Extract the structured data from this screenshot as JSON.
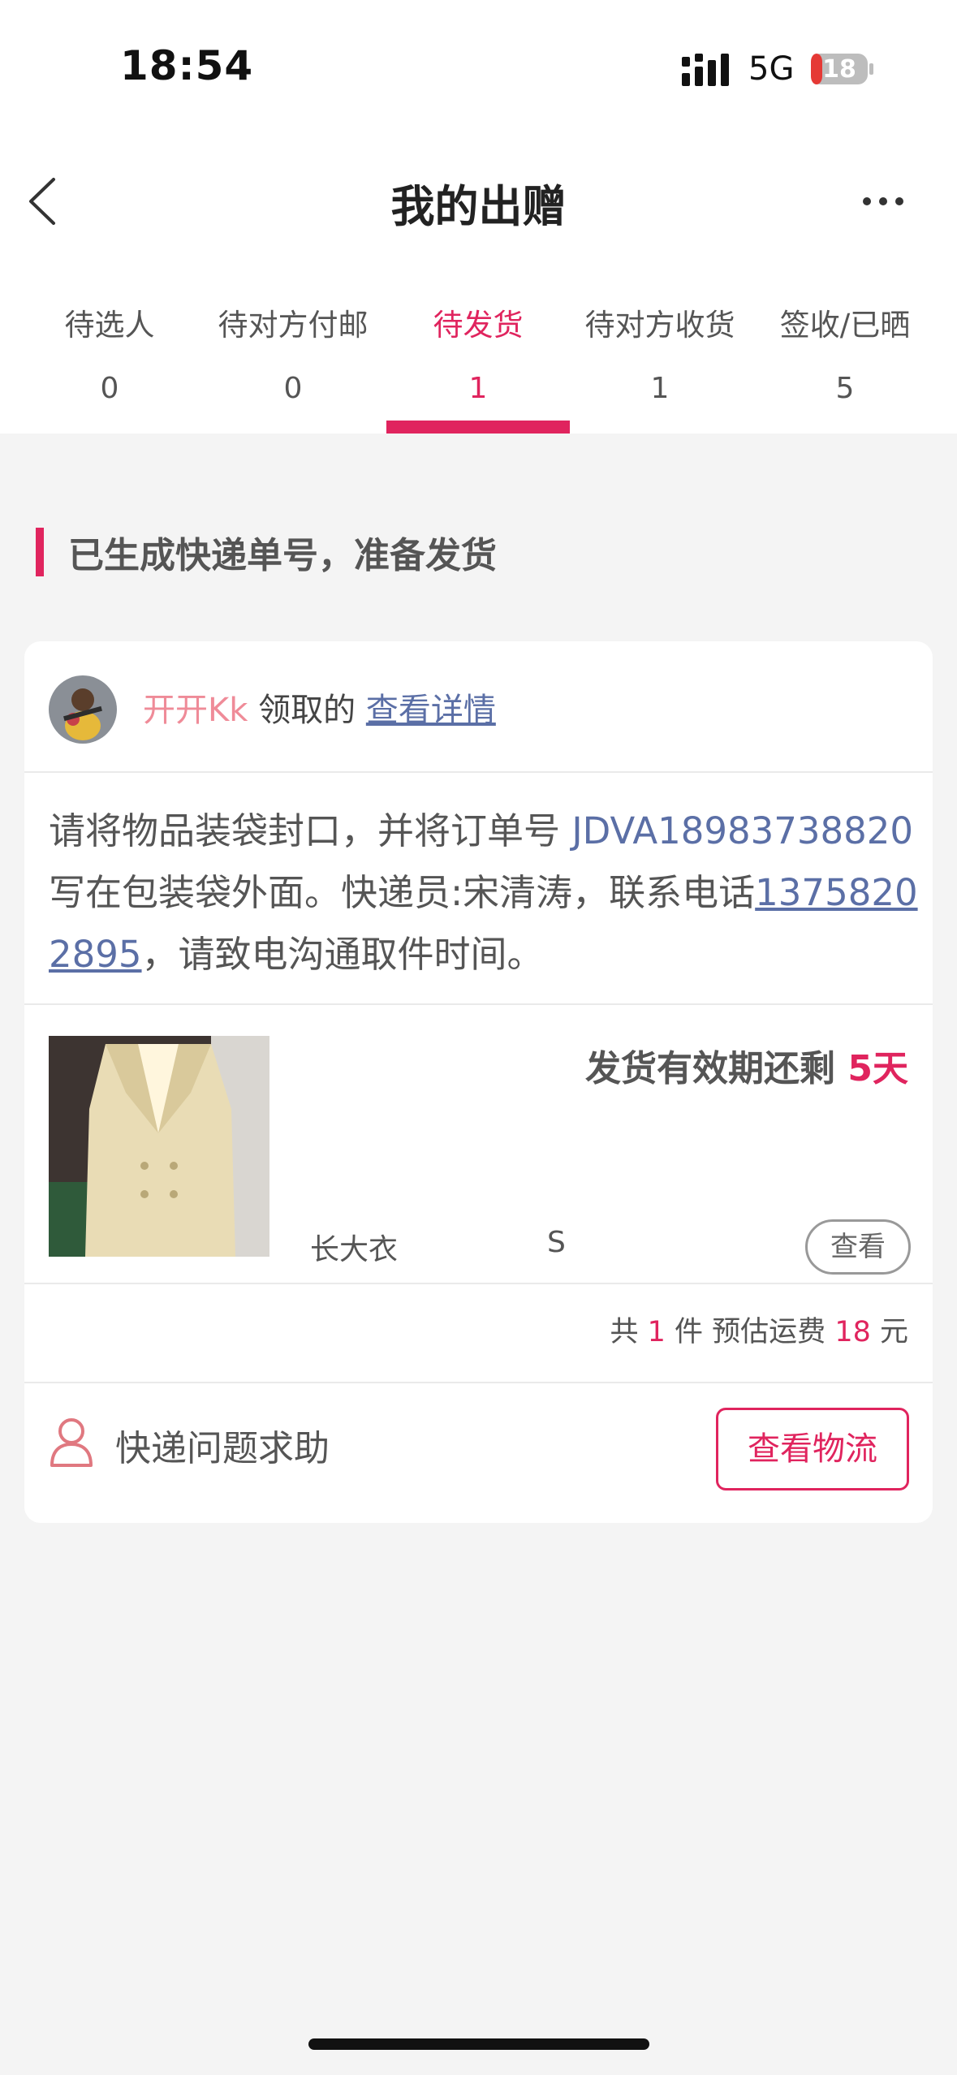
{
  "status": {
    "time": "18:54",
    "network": "5G",
    "battery": "18"
  },
  "header": {
    "title": "我的出赠"
  },
  "tabs": [
    {
      "label": "待选人",
      "count": "0"
    },
    {
      "label": "待对方付邮",
      "count": "0"
    },
    {
      "label": "待发货",
      "count": "1",
      "active": true
    },
    {
      "label": "待对方收货",
      "count": "1"
    },
    {
      "label": "签收/已晒",
      "count": "5"
    }
  ],
  "section": {
    "title": "已生成快递单号，准备发货"
  },
  "order": {
    "user_name": "开开Kk",
    "claimed_text": " 领取的 ",
    "detail_link": "查看详情",
    "instr_part1": "请将物品装袋封口，并将订单号 ",
    "order_no": "JDVA18983738820",
    "instr_part2": " 写在包装袋外面。快递员:宋清涛，联系电话",
    "phone": "13758202895",
    "instr_part3": "，请致电沟通取件时间。",
    "validity_label": "发货有效期还剩 ",
    "validity_days": "5天",
    "item_name": "长大衣",
    "item_size": "S",
    "view_button": "查看",
    "summary": {
      "prefix": "共 ",
      "count": "1",
      "mid": " 件 预估运费 ",
      "fee": "18",
      "suffix": " 元"
    },
    "help_text": "快递问题求助",
    "logistics_button": "查看物流"
  },
  "colors": {
    "accent": "#e0245e",
    "link": "#5b6fa6",
    "username": "#ef8b98"
  }
}
